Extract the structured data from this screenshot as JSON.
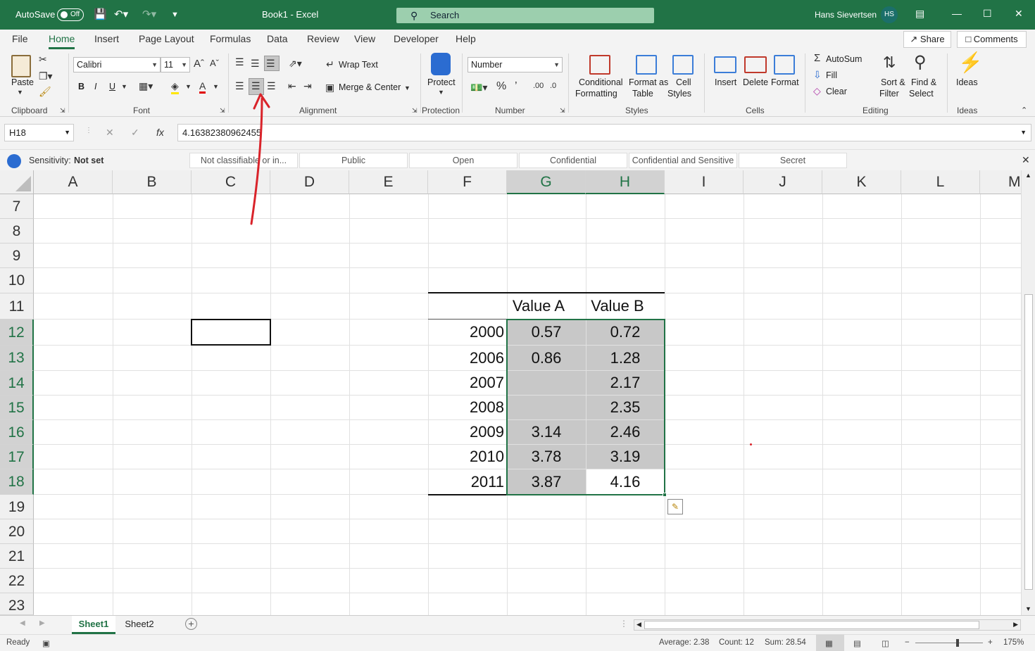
{
  "titlebar": {
    "autosave_label": "AutoSave",
    "autosave_state": "Off",
    "doc_title": "Book1  -  Excel",
    "search_placeholder": "Search",
    "user_name": "Hans Sievertsen",
    "user_initials": "HS"
  },
  "menu": {
    "tabs": [
      "File",
      "Home",
      "Insert",
      "Page Layout",
      "Formulas",
      "Data",
      "Review",
      "View",
      "Developer",
      "Help"
    ],
    "active": "Home",
    "share_label": "Share",
    "comments_label": "Comments"
  },
  "ribbon": {
    "clipboard": {
      "paste": "Paste",
      "label": "Clipboard"
    },
    "font": {
      "name": "Calibri",
      "size": "11",
      "bold": "B",
      "italic": "I",
      "underline": "U",
      "label": "Font"
    },
    "alignment": {
      "wrap_text": "Wrap Text",
      "merge_center": "Merge & Center",
      "label": "Alignment"
    },
    "protection": {
      "protect": "Protect",
      "label": "Protection"
    },
    "number": {
      "format": "Number",
      "label": "Number"
    },
    "styles": {
      "conditional_1": "Conditional",
      "conditional_2": "Formatting",
      "format_table_1": "Format as",
      "format_table_2": "Table",
      "cell_styles_1": "Cell",
      "cell_styles_2": "Styles",
      "label": "Styles"
    },
    "cells": {
      "insert": "Insert",
      "delete": "Delete",
      "format": "Format",
      "label": "Cells"
    },
    "editing": {
      "autosum": "AutoSum",
      "fill": "Fill",
      "clear": "Clear",
      "sort_1": "Sort &",
      "sort_2": "Filter",
      "find_1": "Find &",
      "find_2": "Select",
      "label": "Editing"
    },
    "ideas": {
      "ideas": "Ideas",
      "label": "Ideas"
    }
  },
  "formula_bar": {
    "name_box": "H18",
    "fx": "fx",
    "formula": "4.16382380962455"
  },
  "sensitivity": {
    "label": "Sensitivity:",
    "value": "Not set",
    "options": [
      "Not classifiable or in...",
      "Public",
      "Open",
      "Confidential",
      "Confidential and Sensitive",
      "Secret"
    ]
  },
  "grid": {
    "columns": [
      "A",
      "B",
      "C",
      "D",
      "E",
      "F",
      "G",
      "H",
      "I",
      "J",
      "K",
      "L",
      "M"
    ],
    "rows": [
      "7",
      "8",
      "9",
      "10",
      "11",
      "12",
      "13",
      "14",
      "15",
      "16",
      "17",
      "18",
      "19",
      "20",
      "21",
      "22",
      "23"
    ],
    "table": {
      "header_g": "Value A",
      "header_h": "Value B",
      "years": [
        "2000",
        "2006",
        "2007",
        "2008",
        "2009",
        "2010",
        "2011"
      ],
      "value_a": [
        "0.57",
        "0.86",
        "",
        "",
        "3.14",
        "3.78",
        "3.87"
      ],
      "value_b": [
        "0.72",
        "1.28",
        "2.17",
        "2.35",
        "2.46",
        "3.19",
        "4.16"
      ]
    }
  },
  "sheets": {
    "tabs": [
      "Sheet1",
      "Sheet2"
    ],
    "active": "Sheet1"
  },
  "status": {
    "ready": "Ready",
    "average": "Average: 2.38",
    "count": "Count: 12",
    "sum": "Sum: 28.54",
    "zoom": "175%"
  },
  "colors": {
    "excel_green": "#217346",
    "selection_fill": "#c8c8c8",
    "annotation_red": "#d9232a"
  }
}
